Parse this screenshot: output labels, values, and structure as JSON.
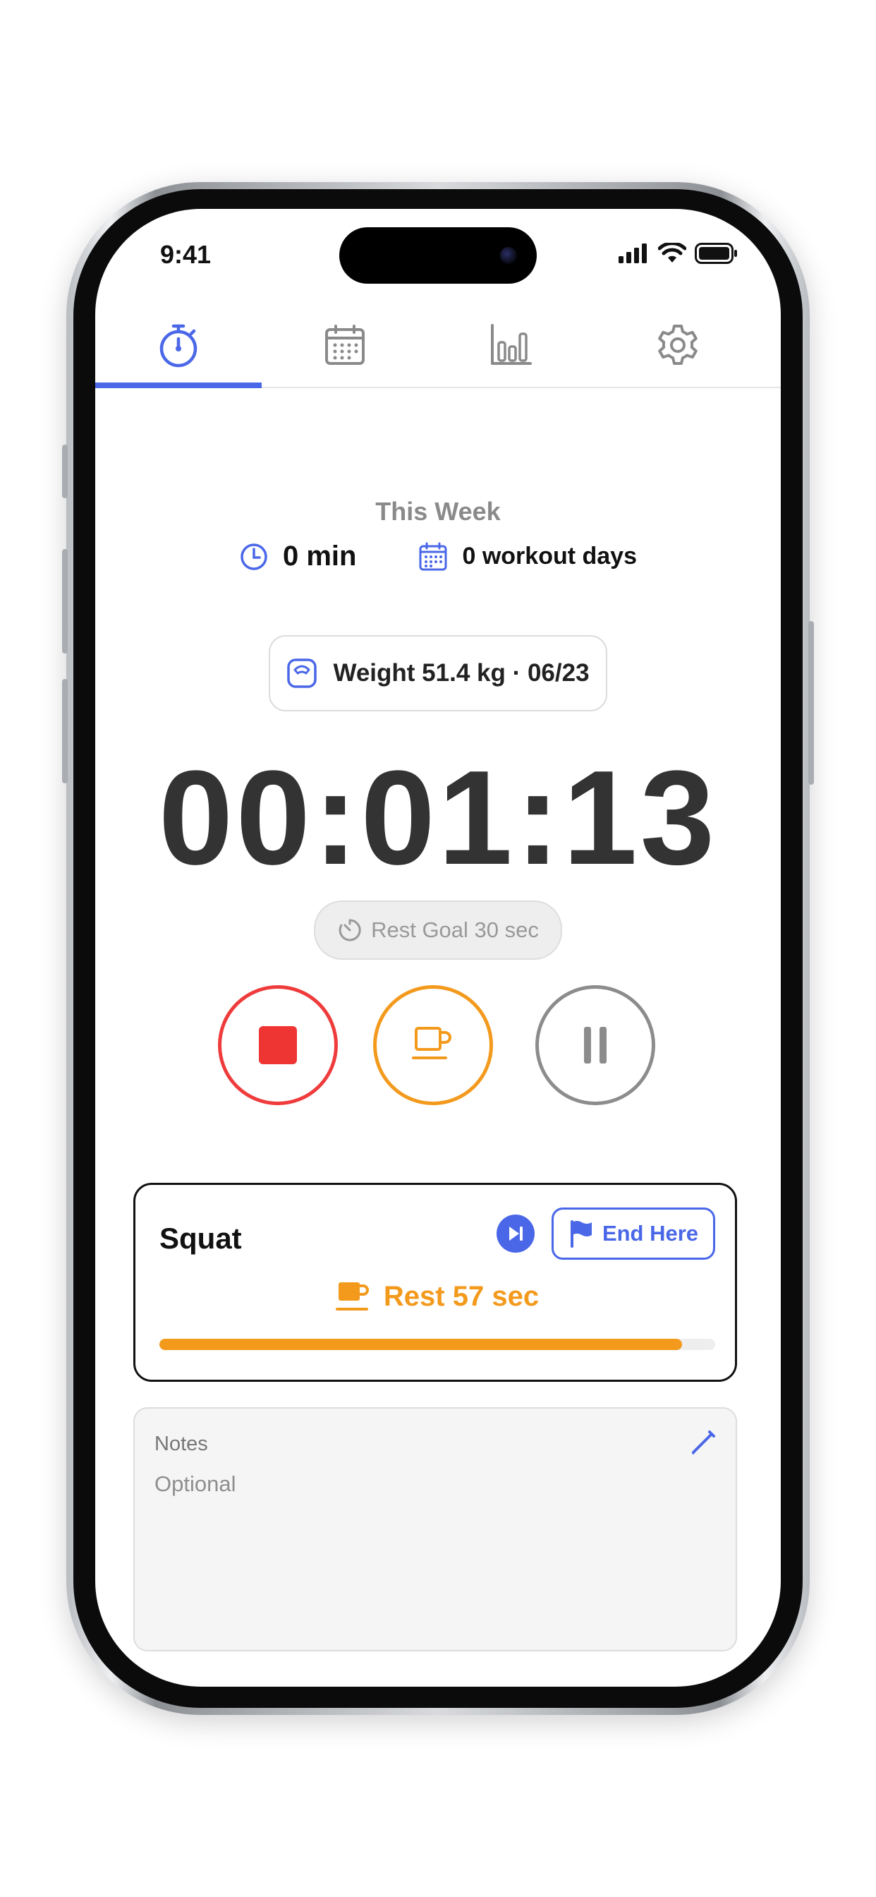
{
  "status_bar": {
    "time": "9:41"
  },
  "tabs": [
    {
      "name": "timer",
      "icon": "stopwatch-icon",
      "active": true
    },
    {
      "name": "calendar",
      "icon": "calendar-icon",
      "active": false
    },
    {
      "name": "stats",
      "icon": "bar-chart-icon",
      "active": false
    },
    {
      "name": "settings",
      "icon": "gear-icon",
      "active": false
    }
  ],
  "week": {
    "title": "This Week",
    "minutes": "0 min",
    "workout_days": "0 workout days"
  },
  "weight_chip": {
    "label": "Weight 51.4 kg · 06/23"
  },
  "timer": {
    "value": "00:01:13"
  },
  "rest_goal": {
    "label": "Rest Goal 30 sec"
  },
  "controls": {
    "stop": "stop-icon",
    "rest": "coffee-cup-icon",
    "pause": "pause-icon"
  },
  "exercise": {
    "name": "Squat",
    "end_here_label": "End Here",
    "rest_label": "Rest 57 sec",
    "rest_progress": 0.94
  },
  "notes": {
    "label": "Notes",
    "placeholder": "Optional",
    "value": ""
  },
  "colors": {
    "accent": "#4a67e8",
    "stop": "#ef3b3b",
    "rest": "#f39a1d",
    "pause": "#8c8c8c"
  }
}
